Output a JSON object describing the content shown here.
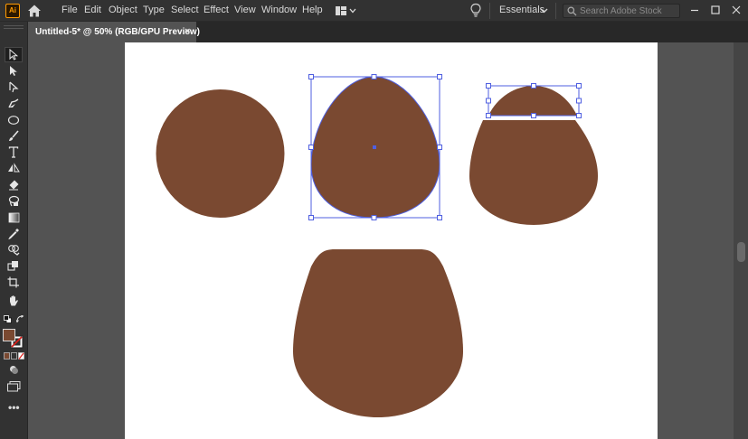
{
  "app": {
    "logo_text": "Ai",
    "name": "Adobe Illustrator"
  },
  "menu": [
    "File",
    "Edit",
    "Object",
    "Type",
    "Select",
    "Effect",
    "View",
    "Window",
    "Help"
  ],
  "workspace": {
    "label": "Essentials"
  },
  "search": {
    "placeholder": "Search Adobe Stock"
  },
  "document_tab": {
    "title": "Untitled-5* @ 50% (RGB/GPU Preview)",
    "close_glyph": "×"
  },
  "tools": [
    "selection-tool",
    "direct-selection-tool",
    "pen-tool",
    "curvature-tool",
    "ellipse-tool",
    "paintbrush-tool",
    "type-tool",
    "reflect-tool",
    "eraser-tool",
    "lasso-tool",
    "gradient-tool",
    "eyedropper-tool",
    "shape-builder-tool",
    "live-paint-tool",
    "artboard-tool",
    "hand-tool"
  ],
  "colors": {
    "fill": "#7a4931",
    "selection": "#4f5fe0",
    "ui_dark": "#323232",
    "canvas_bg": "#535353",
    "artboard": "#ffffff",
    "logo_accent": "#ff9a00"
  },
  "zoom": "50%"
}
